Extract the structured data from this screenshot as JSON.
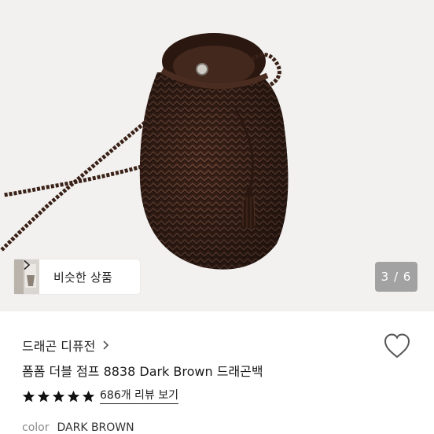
{
  "gallery": {
    "similar_products_label": "비슷한 상품",
    "counter": "3 / 6"
  },
  "product": {
    "brand": "드래곤 디퓨전",
    "title": "폼폼 더블 점프 8838 Dark Brown 드래곤백",
    "rating": 5,
    "reviews_label": "686개 리뷰 보기",
    "color_label": "color",
    "color_value": "DARK BROWN"
  },
  "colors": {
    "leather": "#3a2118",
    "background": "#f2f1ef",
    "counter_bg": "#7a7a7a"
  },
  "icons": {
    "similar": "chevron-right-icon",
    "brand": "chevron-right-icon",
    "wishlist": "heart-outline-icon",
    "rating": "star-icon"
  }
}
